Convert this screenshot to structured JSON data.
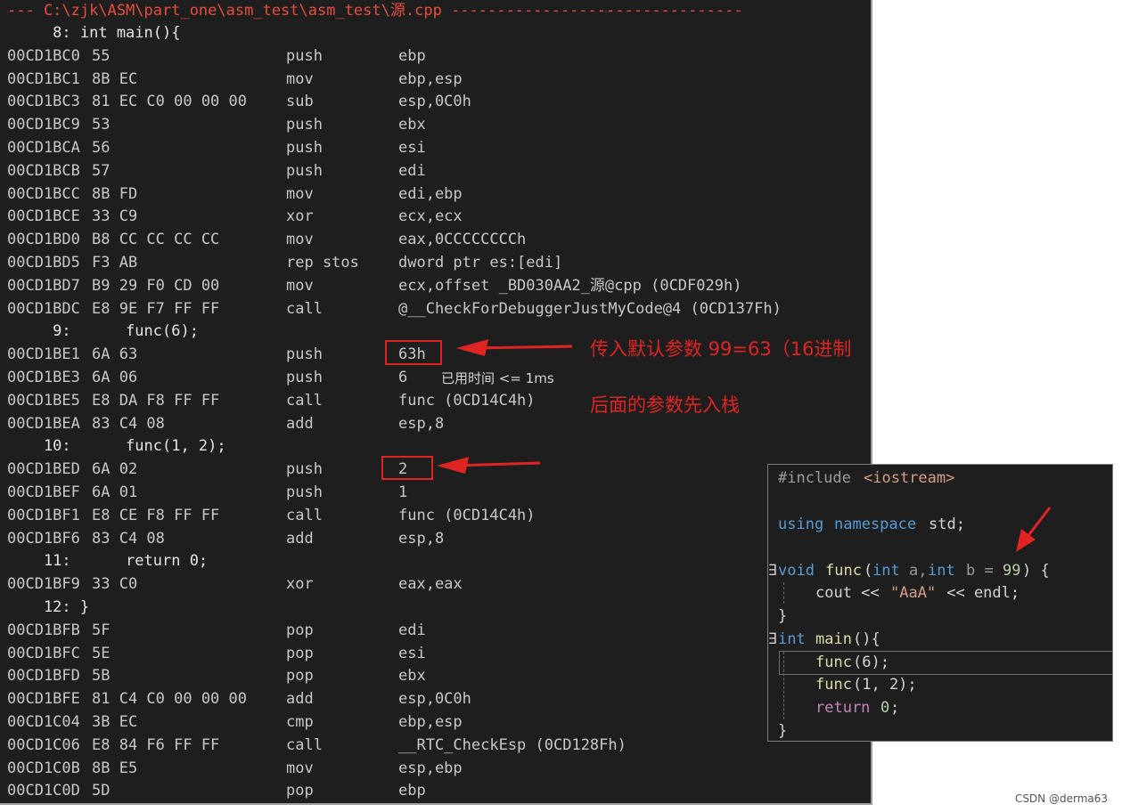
{
  "disasm": {
    "header": "--- C:\\zjk\\ASM\\part_one\\asm_test\\asm_test\\源.cpp --------------------------------",
    "rows": [
      {
        "kind": "src",
        "text": "     8: int main(){"
      },
      {
        "kind": "asm",
        "addr": "00CD1BC0",
        "bytes": "55",
        "mn": "push",
        "op": "ebp"
      },
      {
        "kind": "asm",
        "addr": "00CD1BC1",
        "bytes": "8B EC",
        "mn": "mov",
        "op": "ebp,esp"
      },
      {
        "kind": "asm",
        "addr": "00CD1BC3",
        "bytes": "81 EC C0 00 00 00",
        "mn": "sub",
        "op": "esp,0C0h"
      },
      {
        "kind": "asm",
        "addr": "00CD1BC9",
        "bytes": "53",
        "mn": "push",
        "op": "ebx"
      },
      {
        "kind": "asm",
        "addr": "00CD1BCA",
        "bytes": "56",
        "mn": "push",
        "op": "esi"
      },
      {
        "kind": "asm",
        "addr": "00CD1BCB",
        "bytes": "57",
        "mn": "push",
        "op": "edi"
      },
      {
        "kind": "asm",
        "addr": "00CD1BCC",
        "bytes": "8B FD",
        "mn": "mov",
        "op": "edi,ebp"
      },
      {
        "kind": "asm",
        "addr": "00CD1BCE",
        "bytes": "33 C9",
        "mn": "xor",
        "op": "ecx,ecx"
      },
      {
        "kind": "asm",
        "addr": "00CD1BD0",
        "bytes": "B8 CC CC CC CC",
        "mn": "mov",
        "op": "eax,0CCCCCCCCh"
      },
      {
        "kind": "asm",
        "addr": "00CD1BD5",
        "bytes": "F3 AB",
        "mn": "rep stos",
        "op": "dword ptr es:[edi]"
      },
      {
        "kind": "asm",
        "addr": "00CD1BD7",
        "bytes": "B9 29 F0 CD 00",
        "mn": "mov",
        "op": "ecx,offset _BD030AA2_源@cpp (0CDF029h)"
      },
      {
        "kind": "asm",
        "addr": "00CD1BDC",
        "bytes": "E8 9E F7 FF FF",
        "mn": "call",
        "op": "@__CheckForDebuggerJustMyCode@4 (0CD137Fh)"
      },
      {
        "kind": "src",
        "text": "     9:      func(6);"
      },
      {
        "kind": "asm",
        "addr": "00CD1BE1",
        "bytes": "6A 63",
        "mn": "push",
        "op": "63h"
      },
      {
        "kind": "asm",
        "addr": "00CD1BE3",
        "bytes": "6A 06",
        "mn": "push",
        "op": "6"
      },
      {
        "kind": "asm",
        "addr": "00CD1BE5",
        "bytes": "E8 DA F8 FF FF",
        "mn": "call",
        "op": "func (0CD14C4h)"
      },
      {
        "kind": "asm",
        "addr": "00CD1BEA",
        "bytes": "83 C4 08",
        "mn": "add",
        "op": "esp,8"
      },
      {
        "kind": "src",
        "text": "    10:      func(1, 2);"
      },
      {
        "kind": "asm",
        "addr": "00CD1BED",
        "bytes": "6A 02",
        "mn": "push",
        "op": "2"
      },
      {
        "kind": "asm",
        "addr": "00CD1BEF",
        "bytes": "6A 01",
        "mn": "push",
        "op": "1"
      },
      {
        "kind": "asm",
        "addr": "00CD1BF1",
        "bytes": "E8 CE F8 FF FF",
        "mn": "call",
        "op": "func (0CD14C4h)"
      },
      {
        "kind": "asm",
        "addr": "00CD1BF6",
        "bytes": "83 C4 08",
        "mn": "add",
        "op": "esp,8"
      },
      {
        "kind": "src",
        "text": "    11:      return 0;"
      },
      {
        "kind": "asm",
        "addr": "00CD1BF9",
        "bytes": "33 C0",
        "mn": "xor",
        "op": "eax,eax"
      },
      {
        "kind": "src",
        "text": "    12: }"
      },
      {
        "kind": "asm",
        "addr": "00CD1BFB",
        "bytes": "5F",
        "mn": "pop",
        "op": "edi"
      },
      {
        "kind": "asm",
        "addr": "00CD1BFC",
        "bytes": "5E",
        "mn": "pop",
        "op": "esi"
      },
      {
        "kind": "asm",
        "addr": "00CD1BFD",
        "bytes": "5B",
        "mn": "pop",
        "op": "ebx"
      },
      {
        "kind": "asm",
        "addr": "00CD1BFE",
        "bytes": "81 C4 C0 00 00 00",
        "mn": "add",
        "op": "esp,0C0h"
      },
      {
        "kind": "asm",
        "addr": "00CD1C04",
        "bytes": "3B EC",
        "mn": "cmp",
        "op": "ebp,esp"
      },
      {
        "kind": "asm",
        "addr": "00CD1C06",
        "bytes": "E8 84 F6 FF FF",
        "mn": "call",
        "op": "__RTC_CheckEsp (0CD128Fh)"
      },
      {
        "kind": "asm",
        "addr": "00CD1C0B",
        "bytes": "8B E5",
        "mn": "mov",
        "op": "esp,ebp"
      },
      {
        "kind": "asm",
        "addr": "00CD1C0D",
        "bytes": "5D",
        "mn": "pop",
        "op": "ebp"
      }
    ],
    "timing": "已用时间 <= 1ms"
  },
  "annotations": {
    "note1": "传入默认参数 99=63（16进制",
    "note2": "后面的参数先入栈"
  },
  "code": {
    "include_kw": "#include",
    "include_hdr": "<iostream>",
    "using": "using",
    "namespace": "namespace",
    "std": "std;",
    "void": "void",
    "func": "func",
    "int": "int",
    "param_a": "a,",
    "param_b": "b = ",
    "default_val": "99",
    "sig_end": ") {",
    "cout": "cout << ",
    "str": "\"AaA\"",
    "endl": " << endl;",
    "close": "}",
    "main": "main",
    "main_end": "(){",
    "call1_args": "(6);",
    "call2_args": "(1, 2);",
    "return_kw": "return",
    "return_val": "0",
    "semicolon": ";",
    "marker": "∃",
    "paren_open": "("
  },
  "watermark": "CSDN @derma63",
  "colors": {
    "background": "#1e1e1e",
    "annotation": "#e02424",
    "keyword": "#569cd6",
    "function": "#dcdcaa",
    "string": "#d69d85",
    "number": "#b5cea8"
  }
}
